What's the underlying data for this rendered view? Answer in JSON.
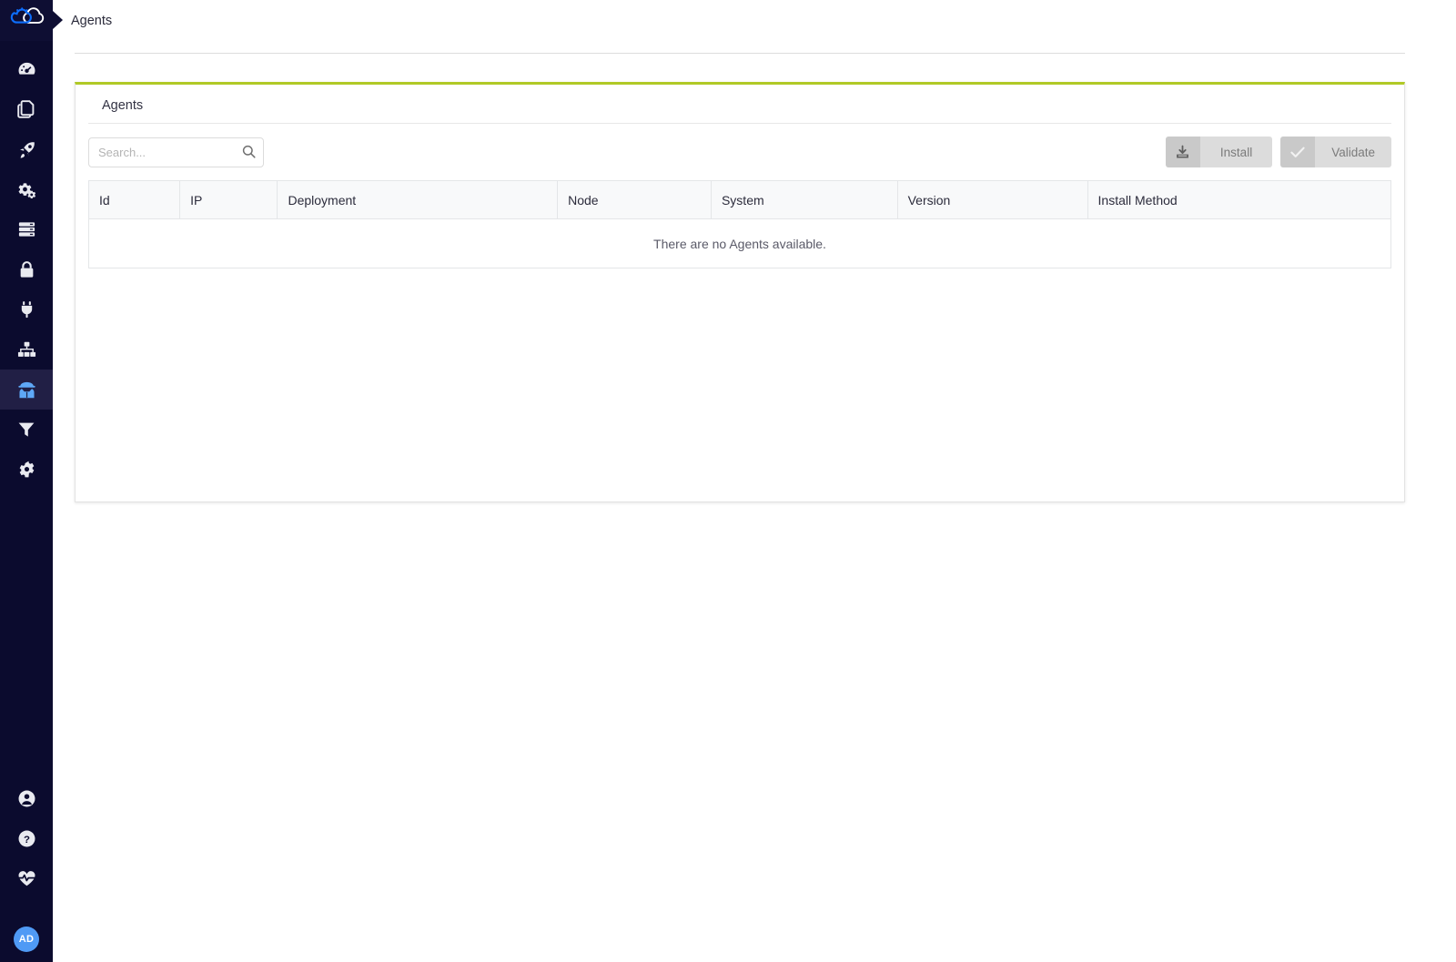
{
  "brand": {
    "logo_icon": "cloud-gear-logo-icon",
    "accent_color": "#b0c926",
    "sidebar_color": "#0b0b2e"
  },
  "header": {
    "breadcrumb": "Agents"
  },
  "sidebar": {
    "items": [
      {
        "icon": "dashboard-gauge-icon",
        "name": "sidebar-item-dashboard",
        "active": false
      },
      {
        "icon": "documents-copy-icon",
        "name": "sidebar-item-documents",
        "active": false
      },
      {
        "icon": "rocket-icon",
        "name": "sidebar-item-deployments",
        "active": false
      },
      {
        "icon": "gears-icon",
        "name": "sidebar-item-services",
        "active": false
      },
      {
        "icon": "server-stack-icon",
        "name": "sidebar-item-servers",
        "active": false
      },
      {
        "icon": "lock-icon",
        "name": "sidebar-item-security",
        "active": false
      },
      {
        "icon": "plug-icon",
        "name": "sidebar-item-integrations",
        "active": false
      },
      {
        "icon": "sitemap-icon",
        "name": "sidebar-item-topology",
        "active": false
      },
      {
        "icon": "agent-spy-icon",
        "name": "sidebar-item-agents",
        "active": true
      },
      {
        "icon": "filter-funnel-icon",
        "name": "sidebar-item-filters",
        "active": false
      },
      {
        "icon": "gear-settings-icon",
        "name": "sidebar-item-settings",
        "active": false
      }
    ],
    "bottom_items": [
      {
        "icon": "user-circle-icon",
        "name": "sidebar-item-account"
      },
      {
        "icon": "help-question-icon",
        "name": "sidebar-item-help"
      },
      {
        "icon": "heartbeat-health-icon",
        "name": "sidebar-item-health"
      }
    ],
    "avatar": {
      "initials": "AD",
      "color": "#4f9af5"
    }
  },
  "card": {
    "title": "Agents"
  },
  "search": {
    "value": "",
    "placeholder": "Search...",
    "icon": "search-icon"
  },
  "toolbar": {
    "install_label": "Install",
    "install_icon": "download-tray-icon",
    "validate_label": "Validate",
    "validate_icon": "check-icon"
  },
  "table": {
    "columns": [
      "Id",
      "IP",
      "Deployment",
      "Node",
      "System",
      "Version",
      "Install Method"
    ],
    "rows": [],
    "empty_message": "There are no Agents available."
  }
}
